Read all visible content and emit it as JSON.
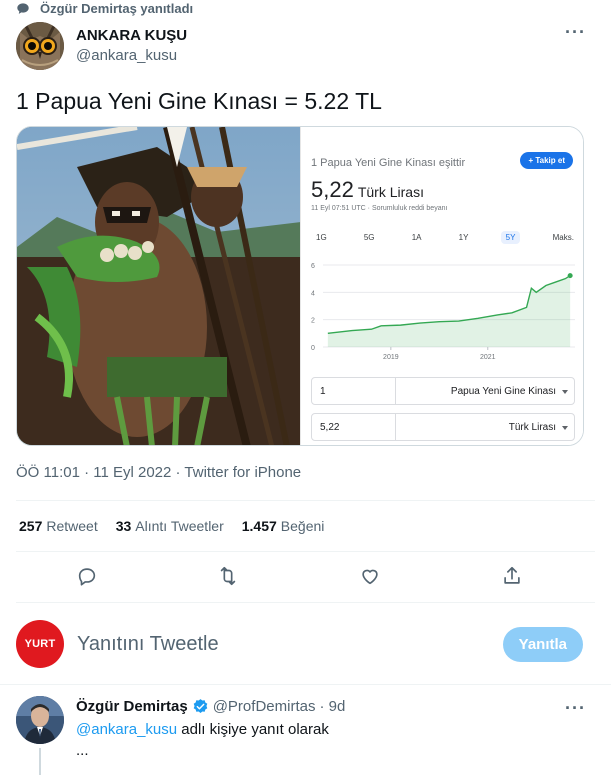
{
  "reply_context": {
    "icon": "speech-bubble-icon",
    "text": "Özgür Demirtaş yanıtladı"
  },
  "author": {
    "name": "ANKARA KUŞU",
    "handle": "@ankara_kusu",
    "avatar": "owl-avatar"
  },
  "tweet": {
    "text": "1 Papua Yeni Gine Kınası = 5.22 TL"
  },
  "media": {
    "currency_widget": {
      "title": "1 Papua Yeni Gine Kinası eşittir",
      "follow_label": "+ Takip et",
      "value": "5,22",
      "unit": "Türk Lirası",
      "meta": "11 Eyl 07:51 UTC · Sorumluluk reddi beyanı",
      "ranges": [
        "1G",
        "5G",
        "1A",
        "1Y",
        "5Y",
        "Maks."
      ],
      "active_range": "5Y",
      "y_ticks": [
        "6",
        "4",
        "2",
        "0"
      ],
      "x_ticks": [
        "2019",
        "2021"
      ],
      "converter": [
        {
          "amount": "1",
          "currency": "Papua Yeni Gine Kinası"
        },
        {
          "amount": "5,22",
          "currency": "Türk Lirası"
        }
      ]
    }
  },
  "chart_data": {
    "type": "area",
    "title": "",
    "xlabel": "",
    "ylabel": "",
    "ylim": [
      0,
      6
    ],
    "x_ticks": [
      "2019",
      "2021"
    ],
    "series": [
      {
        "x": [
          2017.7,
          2018.2,
          2018.6,
          2018.8,
          2019.2,
          2019.6,
          2020.0,
          2020.4,
          2020.8,
          2021.2,
          2021.5,
          2021.8,
          2021.9,
          2022.0,
          2022.2,
          2022.4,
          2022.6,
          2022.7
        ],
        "values": [
          1.0,
          1.2,
          1.3,
          1.55,
          1.6,
          1.75,
          1.85,
          1.9,
          2.1,
          2.35,
          2.5,
          2.9,
          4.3,
          4.0,
          4.5,
          4.75,
          5.0,
          5.22
        ]
      }
    ],
    "accent_color": "#34a853"
  },
  "timestamp": "ÖÖ 11:01 · 11 Eyl 2022 · Twitter for iPhone",
  "stats": [
    {
      "count": "257",
      "label": "Retweet"
    },
    {
      "count": "33",
      "label": "Alıntı Tweetler"
    },
    {
      "count": "1.457",
      "label": "Beğeni"
    }
  ],
  "actions": [
    "reply-icon",
    "retweet-icon",
    "like-icon",
    "share-icon"
  ],
  "compose": {
    "avatar_text": "YURT",
    "placeholder": "Yanıtını Tweetle",
    "button": "Yanıtla"
  },
  "reply": {
    "name": "Özgür Demirtaş",
    "handle": "@ProfDemirtas",
    "time": "· 9d",
    "mention": "@ankara_kusu",
    "reply_to_suffix": " adlı kişiye yanıt olarak",
    "text": "..."
  },
  "colors": {
    "accent": "#1d9bf0",
    "muted": "#536471",
    "reply_button": "#8ecdf8",
    "yurt": "#e0191f"
  }
}
